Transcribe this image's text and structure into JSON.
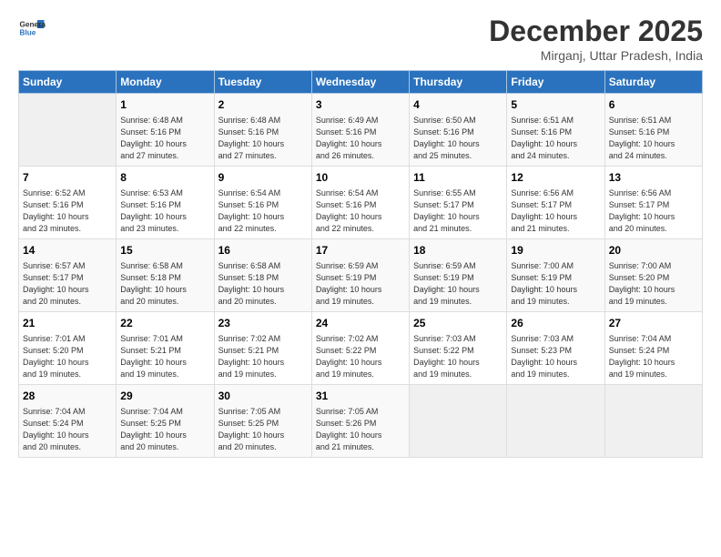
{
  "app": {
    "name_line1": "General",
    "name_line2": "Blue"
  },
  "title": "December 2025",
  "location": "Mirganj, Uttar Pradesh, India",
  "days_of_week": [
    "Sunday",
    "Monday",
    "Tuesday",
    "Wednesday",
    "Thursday",
    "Friday",
    "Saturday"
  ],
  "weeks": [
    [
      {
        "day": "",
        "info": ""
      },
      {
        "day": "1",
        "info": "Sunrise: 6:48 AM\nSunset: 5:16 PM\nDaylight: 10 hours\nand 27 minutes."
      },
      {
        "day": "2",
        "info": "Sunrise: 6:48 AM\nSunset: 5:16 PM\nDaylight: 10 hours\nand 27 minutes."
      },
      {
        "day": "3",
        "info": "Sunrise: 6:49 AM\nSunset: 5:16 PM\nDaylight: 10 hours\nand 26 minutes."
      },
      {
        "day": "4",
        "info": "Sunrise: 6:50 AM\nSunset: 5:16 PM\nDaylight: 10 hours\nand 25 minutes."
      },
      {
        "day": "5",
        "info": "Sunrise: 6:51 AM\nSunset: 5:16 PM\nDaylight: 10 hours\nand 24 minutes."
      },
      {
        "day": "6",
        "info": "Sunrise: 6:51 AM\nSunset: 5:16 PM\nDaylight: 10 hours\nand 24 minutes."
      }
    ],
    [
      {
        "day": "7",
        "info": "Sunrise: 6:52 AM\nSunset: 5:16 PM\nDaylight: 10 hours\nand 23 minutes."
      },
      {
        "day": "8",
        "info": "Sunrise: 6:53 AM\nSunset: 5:16 PM\nDaylight: 10 hours\nand 23 minutes."
      },
      {
        "day": "9",
        "info": "Sunrise: 6:54 AM\nSunset: 5:16 PM\nDaylight: 10 hours\nand 22 minutes."
      },
      {
        "day": "10",
        "info": "Sunrise: 6:54 AM\nSunset: 5:16 PM\nDaylight: 10 hours\nand 22 minutes."
      },
      {
        "day": "11",
        "info": "Sunrise: 6:55 AM\nSunset: 5:17 PM\nDaylight: 10 hours\nand 21 minutes."
      },
      {
        "day": "12",
        "info": "Sunrise: 6:56 AM\nSunset: 5:17 PM\nDaylight: 10 hours\nand 21 minutes."
      },
      {
        "day": "13",
        "info": "Sunrise: 6:56 AM\nSunset: 5:17 PM\nDaylight: 10 hours\nand 20 minutes."
      }
    ],
    [
      {
        "day": "14",
        "info": "Sunrise: 6:57 AM\nSunset: 5:17 PM\nDaylight: 10 hours\nand 20 minutes."
      },
      {
        "day": "15",
        "info": "Sunrise: 6:58 AM\nSunset: 5:18 PM\nDaylight: 10 hours\nand 20 minutes."
      },
      {
        "day": "16",
        "info": "Sunrise: 6:58 AM\nSunset: 5:18 PM\nDaylight: 10 hours\nand 20 minutes."
      },
      {
        "day": "17",
        "info": "Sunrise: 6:59 AM\nSunset: 5:19 PM\nDaylight: 10 hours\nand 19 minutes."
      },
      {
        "day": "18",
        "info": "Sunrise: 6:59 AM\nSunset: 5:19 PM\nDaylight: 10 hours\nand 19 minutes."
      },
      {
        "day": "19",
        "info": "Sunrise: 7:00 AM\nSunset: 5:19 PM\nDaylight: 10 hours\nand 19 minutes."
      },
      {
        "day": "20",
        "info": "Sunrise: 7:00 AM\nSunset: 5:20 PM\nDaylight: 10 hours\nand 19 minutes."
      }
    ],
    [
      {
        "day": "21",
        "info": "Sunrise: 7:01 AM\nSunset: 5:20 PM\nDaylight: 10 hours\nand 19 minutes."
      },
      {
        "day": "22",
        "info": "Sunrise: 7:01 AM\nSunset: 5:21 PM\nDaylight: 10 hours\nand 19 minutes."
      },
      {
        "day": "23",
        "info": "Sunrise: 7:02 AM\nSunset: 5:21 PM\nDaylight: 10 hours\nand 19 minutes."
      },
      {
        "day": "24",
        "info": "Sunrise: 7:02 AM\nSunset: 5:22 PM\nDaylight: 10 hours\nand 19 minutes."
      },
      {
        "day": "25",
        "info": "Sunrise: 7:03 AM\nSunset: 5:22 PM\nDaylight: 10 hours\nand 19 minutes."
      },
      {
        "day": "26",
        "info": "Sunrise: 7:03 AM\nSunset: 5:23 PM\nDaylight: 10 hours\nand 19 minutes."
      },
      {
        "day": "27",
        "info": "Sunrise: 7:04 AM\nSunset: 5:24 PM\nDaylight: 10 hours\nand 19 minutes."
      }
    ],
    [
      {
        "day": "28",
        "info": "Sunrise: 7:04 AM\nSunset: 5:24 PM\nDaylight: 10 hours\nand 20 minutes."
      },
      {
        "day": "29",
        "info": "Sunrise: 7:04 AM\nSunset: 5:25 PM\nDaylight: 10 hours\nand 20 minutes."
      },
      {
        "day": "30",
        "info": "Sunrise: 7:05 AM\nSunset: 5:25 PM\nDaylight: 10 hours\nand 20 minutes."
      },
      {
        "day": "31",
        "info": "Sunrise: 7:05 AM\nSunset: 5:26 PM\nDaylight: 10 hours\nand 21 minutes."
      },
      {
        "day": "",
        "info": ""
      },
      {
        "day": "",
        "info": ""
      },
      {
        "day": "",
        "info": ""
      }
    ]
  ]
}
